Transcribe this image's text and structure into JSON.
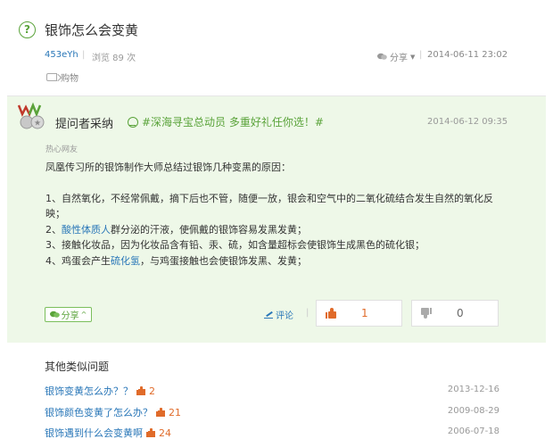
{
  "question": {
    "title": "银饰怎么会变黄",
    "user": "453eYh",
    "views": "浏览 89 次",
    "share_label": "分享",
    "date": "2014-06-11 23:02",
    "tag": "购物",
    "separator": "|"
  },
  "answer": {
    "title": "提问者采纳",
    "promo": "#深海寻宝总动员 多重好礼任你选！#",
    "date": "2014-06-12 09:35",
    "source": "热心网友",
    "intro": "凤凰传习所的银饰制作大师总结过银饰几种变黑的原因：",
    "item1": "1、自然氧化，不经常佩戴，摘下后也不管，随便一放，银会和空气中的二氧化硫结合发生自然的氧化反映；",
    "item2_prefix": "2、",
    "item2_link": "酸性体质人",
    "item2_suffix": "群分泌的汗液，使佩戴的银饰容易发黑发黄；",
    "item3": "3、接触化妆品，因为化妆品含有铅、汞、硫，如含量超标会使银饰生成黑色的硫化银；",
    "item4_prefix": "4、鸡蛋会产生",
    "item4_link": "硫化氢",
    "item4_suffix": "，与鸡蛋接触也会使银饰发黑、发黄；",
    "share_button": "分享",
    "comment_label": "评论",
    "separator": "|",
    "upvotes": "1",
    "downvotes": "0"
  },
  "similar": {
    "heading": "其他类似问题",
    "items": [
      {
        "title": "银饰变黄怎么办？？",
        "count": "2",
        "date": "2013-12-16"
      },
      {
        "title": "银饰颜色变黄了怎么办？",
        "count": "21",
        "date": "2009-08-29"
      },
      {
        "title": "银饰遇到什么会变黄啊",
        "count": "24",
        "date": "2006-07-18"
      }
    ]
  },
  "colors": {
    "accent_green": "#5aa33a",
    "link_blue": "#2a77b8",
    "vote_orange": "#e06b2a",
    "answer_bg": "#eef8e8"
  }
}
